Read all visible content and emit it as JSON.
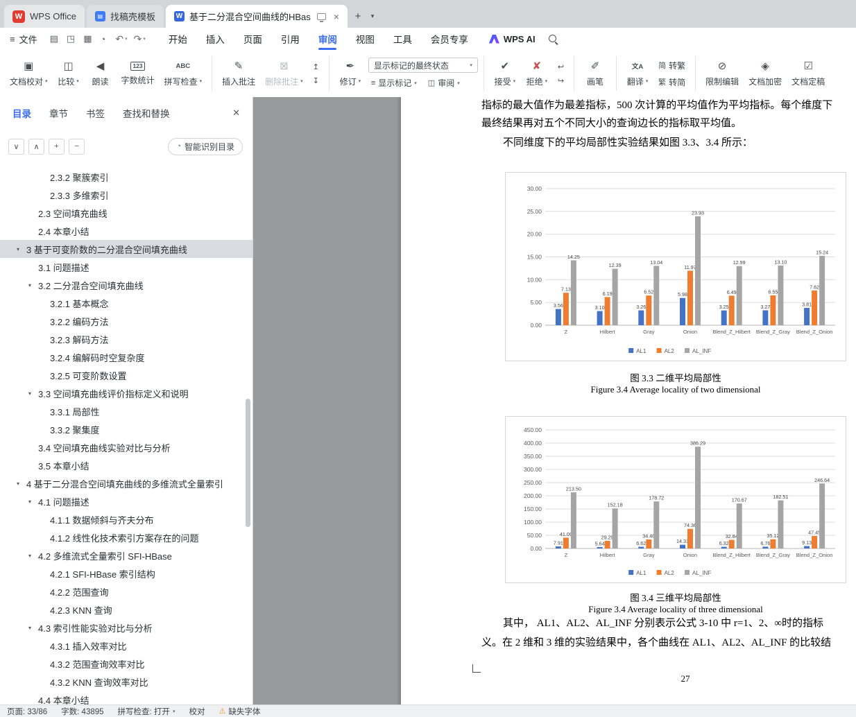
{
  "titlebar": {
    "tabs": [
      {
        "label": "WPS Office"
      },
      {
        "label": "找稿壳模板"
      },
      {
        "label": "基于二分混合空间曲线的HBas",
        "close": "×"
      }
    ],
    "new_tab": "+",
    "tab_list": "▾"
  },
  "menubar": {
    "file_label": "文件",
    "hamburger": "≡",
    "quick_icons": [
      {
        "name": "save-icon",
        "glyph": "▤"
      },
      {
        "name": "export-pdf-icon",
        "glyph": "◳"
      },
      {
        "name": "print-icon",
        "glyph": "▦"
      },
      {
        "name": "print-preview-icon",
        "glyph": "◔"
      }
    ],
    "undo": "↶",
    "redo": "↷",
    "tabs": [
      {
        "label": "开始"
      },
      {
        "label": "插入"
      },
      {
        "label": "页面"
      },
      {
        "label": "引用"
      },
      {
        "label": "审阅",
        "active": true
      },
      {
        "label": "视图"
      },
      {
        "label": "工具"
      },
      {
        "label": "会员专享"
      }
    ],
    "wps_ai_label": "WPS AI"
  },
  "ribbon": {
    "markup_combo": "显示标记的最终状态",
    "groups": [
      {
        "items": [
          {
            "t": "big",
            "name": "proofread",
            "label": "文档校对",
            "glyph": "▣",
            "caret": true
          },
          {
            "t": "big",
            "name": "compare",
            "label": "比较",
            "glyph": "◫",
            "caret": true
          },
          {
            "t": "big",
            "name": "read-aloud",
            "label": "朗读",
            "glyph": "◀"
          },
          {
            "t": "big",
            "name": "word-count",
            "label": "字数统计",
            "glyph": "123",
            "text_icon": true,
            "boxed": true
          },
          {
            "t": "big",
            "name": "spell-check",
            "label": "拼写检查",
            "glyph": "ABC",
            "text_icon": true,
            "caret": true
          }
        ]
      },
      {
        "items": [
          {
            "t": "big",
            "name": "insert-comment",
            "label": "插入批注",
            "glyph": "✎"
          },
          {
            "t": "big",
            "name": "delete-comment",
            "label": "删除批注",
            "glyph": "⊠",
            "caret": true,
            "disabled": true
          },
          {
            "t": "stack",
            "buttons": [
              {
                "name": "previous-comment",
                "glyph": "↥",
                "disabled": true
              },
              {
                "name": "next-comment",
                "glyph": "↧",
                "disabled": true
              }
            ]
          }
        ]
      },
      {
        "items": [
          {
            "t": "big",
            "name": "track-changes",
            "label": "修订",
            "glyph": "✒",
            "caret": true
          },
          {
            "t": "markup-cluster",
            "show_marks": {
              "label": "显示标记",
              "glyph": "≡"
            },
            "review": {
              "label": "审阅",
              "glyph": "◫"
            }
          }
        ]
      },
      {
        "items": [
          {
            "t": "big",
            "name": "accept",
            "label": "接受",
            "glyph": "✔",
            "caret": true
          },
          {
            "t": "big",
            "name": "reject",
            "label": "拒绝",
            "glyph": "✘",
            "caret": true,
            "color": "#c75050"
          },
          {
            "t": "stack",
            "buttons": [
              {
                "name": "previous-change",
                "glyph": "↩"
              },
              {
                "name": "next-change",
                "glyph": "↪"
              }
            ]
          }
        ]
      },
      {
        "items": [
          {
            "t": "big",
            "name": "ink",
            "label": "画笔",
            "glyph": "✐"
          }
        ]
      },
      {
        "items": [
          {
            "t": "big",
            "name": "translate",
            "label": "翻译",
            "glyph": "文A",
            "text_icon": true,
            "caret": true
          },
          {
            "t": "stack",
            "buttons": [
              {
                "name": "to-traditional",
                "glyph": "简",
                "label": "转繁"
              },
              {
                "name": "to-simplified",
                "glyph": "繁",
                "label": "转简"
              }
            ]
          }
        ]
      },
      {
        "items": [
          {
            "t": "big",
            "name": "restrict-editing",
            "label": "限制编辑",
            "glyph": "⊘"
          },
          {
            "t": "big",
            "name": "encrypt",
            "label": "文档加密",
            "glyph": "◈"
          },
          {
            "t": "big",
            "name": "finalize",
            "label": "文档定稿",
            "glyph": "☑"
          }
        ]
      }
    ]
  },
  "sidebar": {
    "tabs": [
      {
        "label": "目录",
        "active": true
      },
      {
        "label": "章节"
      },
      {
        "label": "书签"
      },
      {
        "label": "查找和替换"
      }
    ],
    "close_glyph": "✕",
    "tools": [
      {
        "name": "collapse-all-button",
        "glyph": "∨"
      },
      {
        "name": "expand-all-button",
        "glyph": "∧"
      },
      {
        "name": "zoom-in-button",
        "glyph": "+"
      },
      {
        "name": "zoom-out-button",
        "glyph": "−"
      }
    ],
    "smart_button": "智能识别目录",
    "smart_icon": "◔",
    "toc": [
      {
        "label": "2.3.2 聚簇索引",
        "level": 3
      },
      {
        "label": "2.3.3 多维索引",
        "level": 3
      },
      {
        "label": "2.3 空间填充曲线",
        "level": 2
      },
      {
        "label": "2.4 本章小结",
        "level": 2
      },
      {
        "label": "3 基于可变阶数的二分混合空间填充曲线",
        "level": 1,
        "arrow": true,
        "selected": true
      },
      {
        "label": "3.1 问题描述",
        "level": 2
      },
      {
        "label": "3.2 二分混合空间填充曲线",
        "level": 2,
        "arrow": true
      },
      {
        "label": "3.2.1 基本概念",
        "level": 3
      },
      {
        "label": "3.2.2 编码方法",
        "level": 3
      },
      {
        "label": "3.2.3 解码方法",
        "level": 3
      },
      {
        "label": "3.2.4 编解码时空复杂度",
        "level": 3
      },
      {
        "label": "3.2.5 可变阶数设置",
        "level": 3
      },
      {
        "label": "3.3 空间填充曲线评价指标定义和说明",
        "level": 2,
        "arrow": true
      },
      {
        "label": "3.3.1 局部性",
        "level": 3
      },
      {
        "label": "3.3.2 聚集度",
        "level": 3
      },
      {
        "label": "3.4 空间填充曲线实验对比与分析",
        "level": 2
      },
      {
        "label": "3.5 本章小结",
        "level": 2
      },
      {
        "label": "4 基于二分混合空间填充曲线的多维流式全量索引",
        "level": 1,
        "arrow": true
      },
      {
        "label": "4.1 问题描述",
        "level": 2,
        "arrow": true
      },
      {
        "label": "4.1.1 数据倾斜与齐夫分布",
        "level": 3
      },
      {
        "label": "4.1.2 线性化技术索引方案存在的问题",
        "level": 3
      },
      {
        "label": "4.2 多维流式全量索引 SFI-HBase",
        "level": 2,
        "arrow": true
      },
      {
        "label": "4.2.1 SFI-HBase 索引结构",
        "level": 3
      },
      {
        "label": "4.2.2 范围查询",
        "level": 3
      },
      {
        "label": "4.2.3 KNN 查询",
        "level": 3
      },
      {
        "label": "4.3 索引性能实验对比与分析",
        "level": 2,
        "arrow": true
      },
      {
        "label": "4.3.1 插入效率对比",
        "level": 3
      },
      {
        "label": "4.3.2 范围查询效率对比",
        "level": 3
      },
      {
        "label": "4.3.2 KNN 查询效率对比",
        "level": 3
      },
      {
        "label": "4.4 本章小结",
        "level": 2
      }
    ]
  },
  "document": {
    "para1_line1": "指标的最大值作为最差指标，500 次计算的平均值作为平均指标。每个维度下",
    "para1_line2": "最终结果再对五个不同大小的查询边长的指标取平均值。",
    "para1_line3": "不同维度下的平均局部性实验结果如图 3.3、3.4 所示：",
    "caption1_zh": "图 3.3 二维平均局部性",
    "caption1_en": "Figure 3.4 Average locality of two dimensional",
    "caption2_zh": "图 3.4 三维平均局部性",
    "caption2_en": "Figure 3.4 Average locality of three dimensional",
    "para2_line1": "其中， AL1、AL2、AL_INF 分别表示公式 3-10 中 r=1、2、∞时的指标",
    "para2_line2": "义。在 2 维和 3 维的实验结果中，各个曲线在 AL1、AL2、AL_INF 的比较结",
    "page_number": "27"
  },
  "chart_data": [
    {
      "type": "bar",
      "title": "二维平均局部性",
      "categories": [
        "Z",
        "Hilbert",
        "Gray",
        "Onion",
        "Blend_Z_Hilbert",
        "Blend_Z_Gray",
        "Blend_Z_Onion"
      ],
      "series": [
        {
          "name": "AL1",
          "color": "#4472c4",
          "values": [
            3.56,
            3.1,
            3.26,
            5.98,
            3.25,
            3.27,
            3.81
          ]
        },
        {
          "name": "AL2",
          "color": "#ed7d31",
          "values": [
            7.13,
            6.19,
            6.52,
            11.97,
            6.49,
            6.55,
            7.62
          ]
        },
        {
          "name": "AL_INF",
          "color": "#a5a5a5",
          "values": [
            14.25,
            12.39,
            13.04,
            23.93,
            12.99,
            13.1,
            15.24
          ]
        }
      ],
      "ylim": [
        0,
        30
      ],
      "ystep": 5,
      "grid": true,
      "legend_position": "bottom"
    },
    {
      "type": "bar",
      "title": "三维平均局部性",
      "categories": [
        "Z",
        "Hilbert",
        "Gray",
        "Onion",
        "Blend_Z_Hilbert",
        "Blend_Z_Gray",
        "Blend_Z_Onion"
      ],
      "series": [
        {
          "name": "AL1",
          "color": "#4472c4",
          "values": [
            7.91,
            5.64,
            6.62,
            14.31,
            6.32,
            6.76,
            9.13
          ]
        },
        {
          "name": "AL2",
          "color": "#ed7d31",
          "values": [
            41.09,
            29.29,
            34.4,
            74.36,
            32.84,
            35.12,
            47.45
          ]
        },
        {
          "name": "AL_INF",
          "color": "#a5a5a5",
          "values": [
            213.5,
            152.18,
            178.72,
            386.29,
            170.67,
            182.51,
            246.64
          ]
        }
      ],
      "ylim": [
        0,
        450
      ],
      "ystep": 50,
      "grid": true,
      "legend_position": "bottom"
    }
  ],
  "statusbar": {
    "items": [
      {
        "name": "page-indicator",
        "label": "页面: 33/86"
      },
      {
        "name": "word-count-indicator",
        "label": "字数: 43895"
      },
      {
        "name": "spell-check-status",
        "label": "拼写检查: 打开",
        "caret": true
      },
      {
        "name": "proofread-status",
        "label": "校对"
      },
      {
        "name": "missing-font-warning",
        "label": "缺失字体",
        "warn": true
      }
    ]
  },
  "colors": {
    "accent": "#3c6cf0",
    "al1": "#4472c4",
    "al2": "#ed7d31",
    "al_inf": "#a5a5a5",
    "warning": "#ed9a2e",
    "doc_background": "#989a9d"
  }
}
